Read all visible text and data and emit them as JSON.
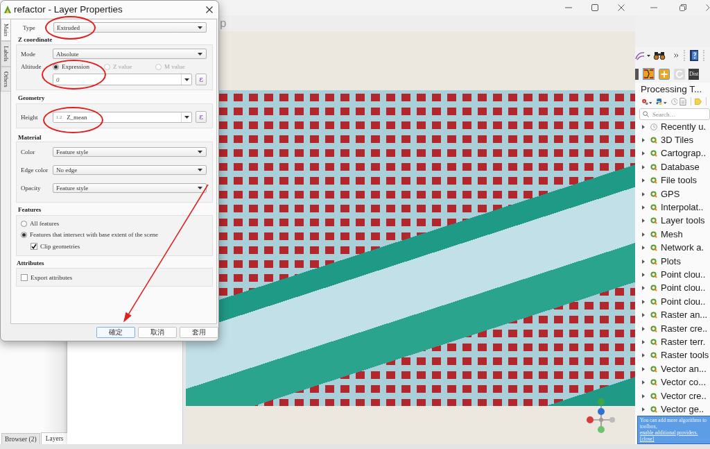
{
  "dialog": {
    "title": "refactor - Layer Properties",
    "side_tabs": [
      {
        "label": "Main",
        "selected": true
      },
      {
        "label": "Labels",
        "selected": false
      },
      {
        "label": "Others",
        "selected": false
      }
    ],
    "type": {
      "label": "Type",
      "value": "Extruded",
      "highlighted": true
    },
    "z_coordinate": {
      "heading": "Z coordinate",
      "mode": {
        "label": "Mode",
        "value": "Absolute"
      },
      "altitude": {
        "label": "Altitude",
        "options": [
          {
            "label": "Expression",
            "selected": true,
            "disabled": false
          },
          {
            "label": "Z value",
            "selected": false,
            "disabled": true
          },
          {
            "label": "M value",
            "selected": false,
            "disabled": true
          }
        ],
        "expression": "0",
        "expression_button": "ε",
        "highlighted": true
      }
    },
    "geometry": {
      "heading": "Geometry",
      "height": {
        "label": "Height",
        "type_badge": "1.2",
        "value": "Z_mean",
        "expression_button": "ε",
        "highlighted": true
      }
    },
    "material": {
      "heading": "Material",
      "rows": [
        {
          "label": "Color",
          "value": "Feature style"
        },
        {
          "label": "Edge color",
          "value": "No edge"
        },
        {
          "label": "Opacity",
          "value": "Feature style"
        }
      ]
    },
    "features": {
      "heading": "Features",
      "options": [
        {
          "label": "All features",
          "selected": false
        },
        {
          "label": "Features that intersect with base extent of the scene",
          "selected": true
        }
      ],
      "clip": {
        "label": "Clip geometries",
        "checked": true
      }
    },
    "attributes": {
      "heading": "Attributes",
      "export": {
        "label": "Export attributes",
        "checked": false
      }
    },
    "buttons": [
      {
        "label": "確定",
        "focused": true
      },
      {
        "label": "取消",
        "focused": false
      },
      {
        "label": "套用",
        "focused": false
      }
    ]
  },
  "view_window": {
    "title": "p"
  },
  "left_dock": {
    "tabs": [
      {
        "label": "Browser (2)",
        "selected": false
      },
      {
        "label": "Layers",
        "selected": true
      }
    ]
  },
  "toolbar": {
    "dist_button": "Dist"
  },
  "processing": {
    "title": "Processing T...",
    "search": {
      "placeholder": "Search…"
    },
    "items": [
      {
        "label": "Recently u.",
        "kind": "recent"
      },
      {
        "label": "3D Tiles",
        "kind": "provider"
      },
      {
        "label": "Cartograp..",
        "kind": "provider"
      },
      {
        "label": "Database",
        "kind": "provider"
      },
      {
        "label": "File tools",
        "kind": "provider"
      },
      {
        "label": "GPS",
        "kind": "provider"
      },
      {
        "label": "Interpolat..",
        "kind": "provider"
      },
      {
        "label": "Layer tools",
        "kind": "provider"
      },
      {
        "label": "Mesh",
        "kind": "provider"
      },
      {
        "label": "Network a.",
        "kind": "provider"
      },
      {
        "label": "Plots",
        "kind": "provider"
      },
      {
        "label": "Point clou..",
        "kind": "provider"
      },
      {
        "label": "Point clou..",
        "kind": "provider"
      },
      {
        "label": "Point clou..",
        "kind": "provider"
      },
      {
        "label": "Raster an...",
        "kind": "provider"
      },
      {
        "label": "Raster cre..",
        "kind": "provider"
      },
      {
        "label": "Raster terr.",
        "kind": "provider"
      },
      {
        "label": "Raster tools",
        "kind": "provider"
      },
      {
        "label": "Vector an...",
        "kind": "provider"
      },
      {
        "label": "Vector co...",
        "kind": "provider"
      },
      {
        "label": "Vector cre..",
        "kind": "provider"
      },
      {
        "label": "Vector ge..",
        "kind": "provider"
      }
    ],
    "message": {
      "text": "You can add more algorithms to toolbox,",
      "link": "enable additional providers.",
      "close": "[close]"
    }
  }
}
